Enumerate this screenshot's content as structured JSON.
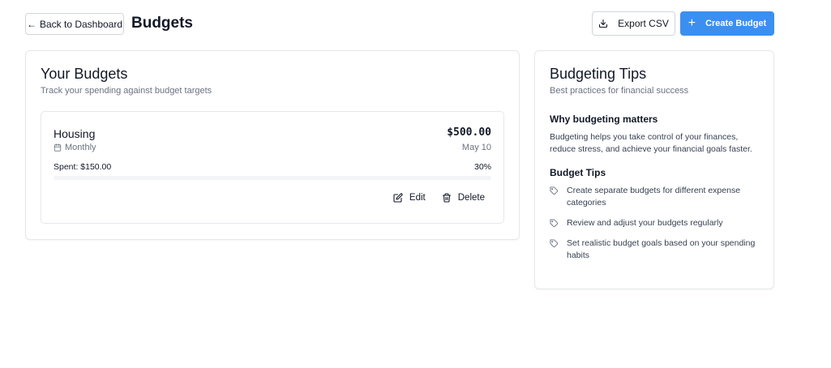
{
  "header": {
    "back_label": "Back to Dashboard",
    "back_arrow": "←",
    "title": "Budgets",
    "export_label": "Export CSV",
    "create_label": "Create Budget",
    "create_icon": "+"
  },
  "budgets_card": {
    "title": "Your Budgets",
    "subtitle": "Track your spending against budget targets",
    "items": [
      {
        "name": "Housing",
        "period": "Monthly",
        "amount": "$500.00",
        "date": "May 10",
        "spent": "Spent: $150.00",
        "percent": "30%",
        "progress_fraction": 0.3,
        "edit_label": "Edit",
        "delete_label": "Delete"
      }
    ]
  },
  "tips_card": {
    "title": "Budgeting Tips",
    "subtitle": "Best practices for financial success",
    "why_heading": "Why budgeting matters",
    "why_text": "Budgeting helps you take control of your finances, reduce stress, and achieve your financial goals faster.",
    "tips_heading": "Budget Tips",
    "tips": [
      "Create separate budgets for different expense categories",
      "Review and adjust your budgets regularly",
      "Set realistic budget goals based on your spending habits"
    ]
  },
  "colors": {
    "primary": "#3b8ff0",
    "muted_text": "#6b7280",
    "border": "#e5e7eb"
  }
}
